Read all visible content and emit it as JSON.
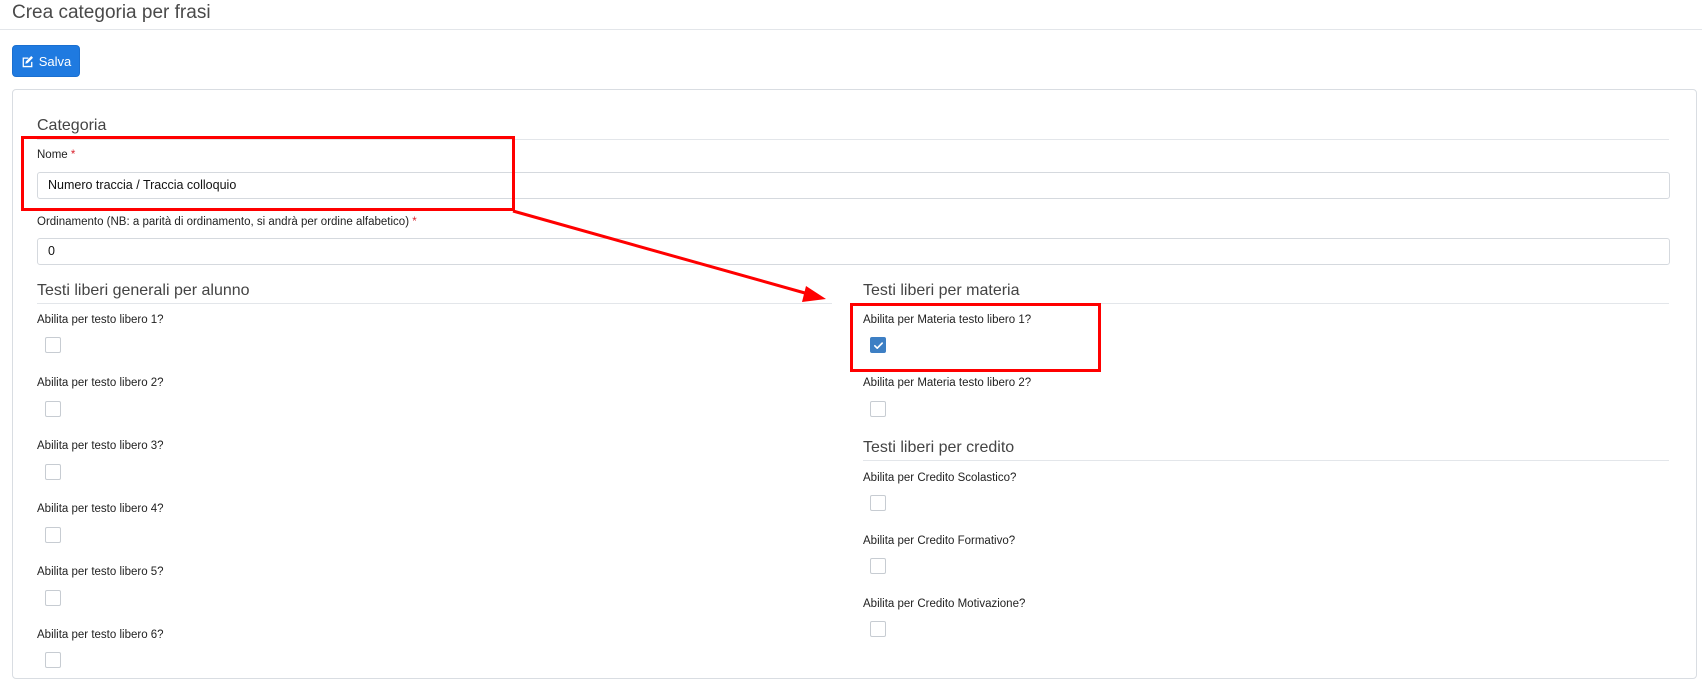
{
  "page": {
    "title": "Crea categoria per frasi"
  },
  "toolbar": {
    "save_label": "Salva",
    "save_icon": "edit-icon"
  },
  "category": {
    "legend": "Categoria",
    "name_label": "Nome",
    "name_value": "Numero traccia / Traccia colloquio",
    "order_label": "Ordinamento (NB: a parità di ordinamento, si andrà per ordine alfabetico)",
    "order_value": "0",
    "required_mark": "*"
  },
  "general": {
    "legend": "Testi liberi generali per alunno",
    "items": [
      {
        "label": "Abilita per testo libero 1?",
        "checked": false
      },
      {
        "label": "Abilita per testo libero 2?",
        "checked": false
      },
      {
        "label": "Abilita per testo libero 3?",
        "checked": false
      },
      {
        "label": "Abilita per testo libero 4?",
        "checked": false
      },
      {
        "label": "Abilita per testo libero 5?",
        "checked": false
      },
      {
        "label": "Abilita per testo libero 6?",
        "checked": false
      }
    ]
  },
  "subject": {
    "legend": "Testi liberi per materia",
    "items": [
      {
        "label": "Abilita per Materia testo libero 1?",
        "checked": true
      },
      {
        "label": "Abilita per Materia testo libero 2?",
        "checked": false
      }
    ]
  },
  "credit": {
    "legend": "Testi liberi per credito",
    "items": [
      {
        "label": "Abilita per Credito Scolastico?",
        "checked": false
      },
      {
        "label": "Abilita per Credito Formativo?",
        "checked": false
      },
      {
        "label": "Abilita per Credito Motivazione?",
        "checked": false
      }
    ]
  },
  "colors": {
    "primary": "#1f7ae0",
    "checked": "#3d7fc4",
    "annotation": "#ff0000",
    "required": "#d9232f"
  }
}
